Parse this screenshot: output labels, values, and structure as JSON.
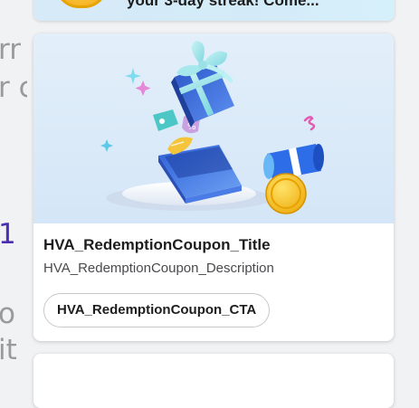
{
  "background_fragments": [
    "rr",
    "r c",
    "1",
    "o",
    "it"
  ],
  "top_card": {
    "text": "your 3-day streak! Come..."
  },
  "coupon_card": {
    "title": "HVA_RedemptionCoupon_Title",
    "description": "HVA_RedemptionCoupon_Description",
    "cta_label": "HVA_RedemptionCoupon_CTA",
    "hero_icon": "gift-box-illustration",
    "hero_background": "#dcebf9"
  }
}
